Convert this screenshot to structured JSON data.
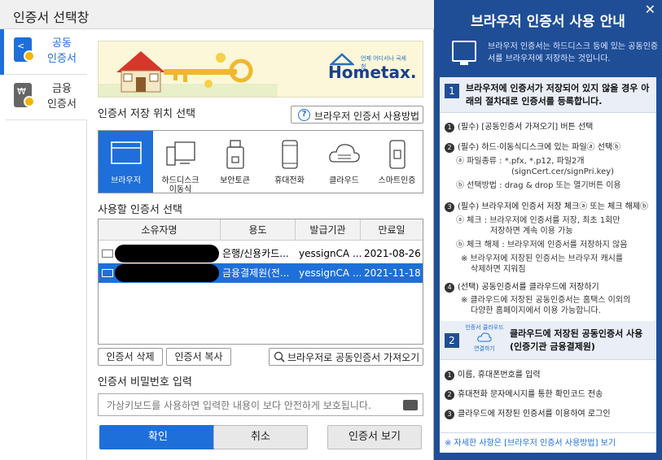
{
  "dialog": {
    "title": "인증서 선택창"
  },
  "sidebar": {
    "items": [
      {
        "label": "공동\n인증서",
        "line1": "공동",
        "line2": "인증서"
      },
      {
        "line1": "금융",
        "line2": "인증서"
      }
    ]
  },
  "banner": {
    "logo_small": "언제 어디서나 국세청",
    "logo_main": "Hometax."
  },
  "storage": {
    "label": "인증서 저장 위치 선택",
    "help_button": "브라우저 인증서 사용방법",
    "locations": [
      {
        "label": "브라우저",
        "icon": "browser-icon"
      },
      {
        "label": "하드디스크\n이동식",
        "line1": "하드디스크",
        "line2": "이동식",
        "icon": "harddisk-icon"
      },
      {
        "label": "보안토큰",
        "icon": "token-icon"
      },
      {
        "label": "휴대전화",
        "icon": "phone-icon"
      },
      {
        "label": "클라우드",
        "icon": "cloud-icon"
      },
      {
        "label": "스마트인증",
        "icon": "smartcard-icon"
      }
    ]
  },
  "cert_table": {
    "label": "사용할 인증서 선택",
    "columns": [
      "소유자명",
      "용도",
      "발급기관",
      "만료일"
    ],
    "rows": [
      {
        "owner": "",
        "usage": "은행/신용카드...",
        "issuer": "yessignCA ...",
        "expiry": "2021-08-26"
      },
      {
        "owner": "",
        "usage": "금융결제원(전...",
        "issuer": "yessignCA ...",
        "expiry": "2021-11-18"
      }
    ]
  },
  "actions": {
    "delete": "인증서 삭제",
    "copy": "인증서 복사",
    "import": "브라우저로 공동인증서 가져오기"
  },
  "password": {
    "label": "인증서 비밀번호 입력",
    "placeholder": "가상키보드를 사용하면 입력한 내용이 보다 안전하게 보호됩니다."
  },
  "buttons": {
    "confirm": "확인",
    "cancel": "취소",
    "view": "인증서 보기"
  },
  "guide": {
    "title": "브라우저 인증서 사용 안내",
    "intro": "브라우저 인증서는 하드디스크 등에 있는 공동인증서를 브라우저에 저장하는 것입니다.",
    "step1": {
      "num": "1",
      "text": "브라우저에 인증서가 저장되어 있지 않을 경우 아래의 절차대로 인증서를 등록합니다.",
      "b1": "(필수) [공동인증서 가져오기] 버튼 선택",
      "b2": "(필수) 하드·이동식디스크에 있는 파일ⓐ 선택ⓑ",
      "b2a": "ⓐ 파일종류 : *.pfx, *.p12, 파일2개\n(signCert.cer/signPri.key)",
      "b2a1": "ⓐ 파일종류 : *.pfx, *.p12, 파일2개",
      "b2a2": "(signCert.cer/signPri.key)",
      "b2b": "ⓑ 선택방법 : drag & drop 또는 열기버튼 이용",
      "b3": "(필수) 브라우저에 인증서 저장 체크ⓐ 또는 체크 해제ⓑ",
      "b3a1": "ⓐ 체크 :  브라우저에 인증서를 저장, 최초 1회만",
      "b3a2": "저장하면 계속 이용 가능",
      "b3b": "ⓑ 체크 해제 : 브라우저에 인증서를 저장하지 않음",
      "b3c1": "※ 브라우저에 저장된 인증서는 브라우저 캐시를",
      "b3c2": "삭제하면 지워짐",
      "b4": "(선택) 공동인증서를 클라우드에 저장하기",
      "b4a1": "※ 클라우드에 저장된 공동인증서는 홈택스 이외의",
      "b4a2": "다양한 홈페이지에서 이용 가능합니다."
    },
    "step2": {
      "num": "2",
      "badge_top": "인증서 클라우드",
      "badge_bottom": "연결하기",
      "text": "클라우드에 저장된 공동인증서 사용 (인증기관 금융결제원)",
      "b1": "이름, 휴대폰번호를 입력",
      "b2": "휴대전화 문자메시지를 통한 확인코드 전송",
      "b3": "클라우드에 저장된 인증서를 이용하여 로그인"
    },
    "more": "※ 자세한 사항은 [브라우저 인증서 사용방법] 보기"
  }
}
